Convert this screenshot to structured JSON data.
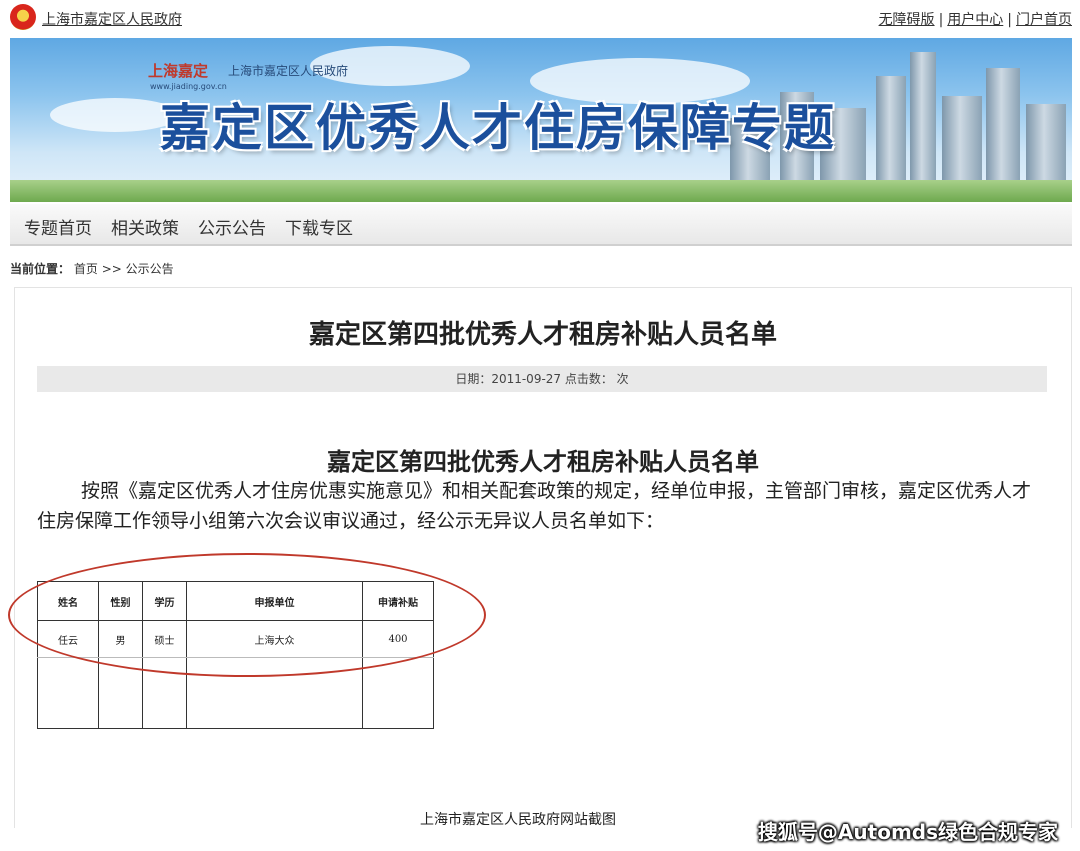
{
  "top": {
    "site_link": "上海市嘉定区人民政府",
    "links": [
      "无障碍版",
      "用户中心",
      "门户首页"
    ],
    "separator": "|"
  },
  "banner": {
    "logo_cn": "上海嘉定",
    "logo_gov": "上海市嘉定区人民政府",
    "logo_url": "www.jiading.gov.cn",
    "title": "嘉定区优秀人才住房保障专题"
  },
  "nav": {
    "items": [
      "专题首页",
      "相关政策",
      "公示公告",
      "下载专区"
    ]
  },
  "breadcrumb": {
    "label": "当前位置：",
    "home": "首页",
    "arrow": ">>",
    "current": "公示公告"
  },
  "article": {
    "title": "嘉定区第四批优秀人才租房补贴人员名单",
    "info": "日期：2011-09-27 点击数： 次",
    "body_title": "嘉定区第四批优秀人才租房补贴人员名单",
    "paragraph": "按照《嘉定区优秀人才住房优惠实施意见》和相关配套政策的规定，经单位申报，主管部门审核，嘉定区优秀人才住房保障工作领导小组第六次会议审议通过，经公示无异议人员名单如下：",
    "table": {
      "headers": [
        "姓名",
        "性别",
        "学历",
        "申报单位",
        "申请补贴"
      ],
      "rows": [
        [
          "任云",
          "男",
          "硕士",
          "上海大众",
          "400"
        ]
      ]
    }
  },
  "caption": "上海市嘉定区人民政府网站截图",
  "watermark": "搜狐号@Automds绿色合规专家",
  "colors": {
    "title_blue": "#1b4f9c",
    "oval_red": "#c0392b",
    "infobar_gray": "#e9e9e9"
  }
}
